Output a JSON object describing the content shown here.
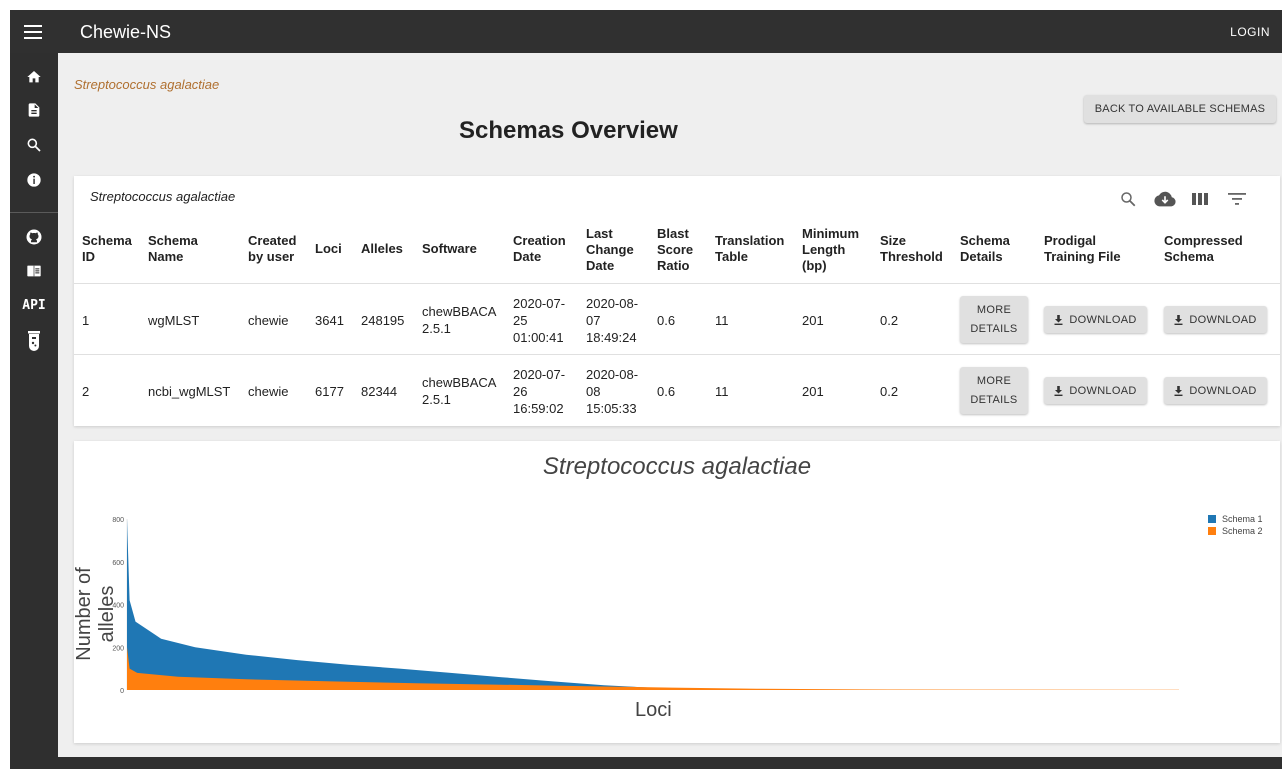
{
  "app": {
    "title": "Chewie-NS",
    "login_label": "LOGIN"
  },
  "sidebar": {
    "items": [
      {
        "name": "home",
        "icon": "home-icon"
      },
      {
        "name": "documentation",
        "icon": "document-icon"
      },
      {
        "name": "search",
        "icon": "search-icon"
      },
      {
        "name": "about",
        "icon": "info-icon"
      },
      {
        "name": "github",
        "icon": "github-icon"
      },
      {
        "name": "readme",
        "icon": "book-icon"
      },
      {
        "name": "api",
        "label": "API"
      },
      {
        "name": "test",
        "icon": "flask-icon"
      }
    ]
  },
  "page": {
    "breadcrumb": "Streptococcus agalactiae",
    "title": "Schemas Overview",
    "back_button": "BACK TO AVAILABLE SCHEMAS"
  },
  "table": {
    "title": "Streptococcus agalactiae",
    "toolbar_icons": [
      "search-icon",
      "cloud-download-icon",
      "view-column-icon",
      "filter-icon"
    ],
    "columns": [
      "Schema ID",
      "Schema Name",
      "Created by user",
      "Loci",
      "Alleles",
      "Software",
      "Creation Date",
      "Last Change Date",
      "Blast Score Ratio",
      "Translation Table",
      "Minimum Length (bp)",
      "Size Threshold",
      "Schema Details",
      "Prodigal Training File",
      "Compressed Schema"
    ],
    "rows": [
      {
        "schema_id": "1",
        "schema_name": "wgMLST",
        "created_by": "chewie",
        "loci": "3641",
        "alleles": "248195",
        "software": "chewBBACA 2.5.1",
        "creation_date": "2020-07-25 01:00:41",
        "last_change_date": "2020-08-07 18:49:24",
        "bsr": "0.6",
        "translation_table": "11",
        "min_length": "201",
        "size_threshold": "0.2",
        "details_label": "MORE DETAILS",
        "prodigal_label": "DOWNLOAD",
        "compressed_label": "DOWNLOAD"
      },
      {
        "schema_id": "2",
        "schema_name": "ncbi_wgMLST",
        "created_by": "chewie",
        "loci": "6177",
        "alleles": "82344",
        "software": "chewBBACA 2.5.1",
        "creation_date": "2020-07-26 16:59:02",
        "last_change_date": "2020-08-08 15:05:33",
        "bsr": "0.6",
        "translation_table": "11",
        "min_length": "201",
        "size_threshold": "0.2",
        "details_label": "MORE DETAILS",
        "prodigal_label": "DOWNLOAD",
        "compressed_label": "DOWNLOAD"
      }
    ]
  },
  "chart_data": {
    "type": "bar",
    "title": "Streptococcus agalactiae",
    "xlabel": "Loci",
    "ylabel": "Number of alleles",
    "ylim": [
      0,
      800
    ],
    "yticks": [
      0,
      200,
      400,
      600,
      800
    ],
    "legend_position": "top-right",
    "grid": false,
    "series": [
      {
        "name": "Schema 1",
        "color": "#1f77b4",
        "loci_count": 3641,
        "sorted_profile": [
          [
            0,
            800
          ],
          [
            15,
            420
          ],
          [
            50,
            320
          ],
          [
            200,
            240
          ],
          [
            400,
            200
          ],
          [
            700,
            165
          ],
          [
            1000,
            140
          ],
          [
            1300,
            118
          ],
          [
            1600,
            100
          ],
          [
            1900,
            80
          ],
          [
            2200,
            60
          ],
          [
            2500,
            40
          ],
          [
            2800,
            22
          ],
          [
            3100,
            10
          ],
          [
            3400,
            4
          ],
          [
            3641,
            1
          ]
        ]
      },
      {
        "name": "Schema 2",
        "color": "#ff7f0e",
        "loci_count": 6177,
        "sorted_profile": [
          [
            0,
            200
          ],
          [
            15,
            100
          ],
          [
            60,
            80
          ],
          [
            300,
            62
          ],
          [
            700,
            50
          ],
          [
            1200,
            40
          ],
          [
            1700,
            32
          ],
          [
            2200,
            25
          ],
          [
            2700,
            18
          ],
          [
            3200,
            11
          ],
          [
            3700,
            6
          ],
          [
            4300,
            3
          ],
          [
            5000,
            2
          ],
          [
            6177,
            1
          ]
        ]
      }
    ]
  }
}
